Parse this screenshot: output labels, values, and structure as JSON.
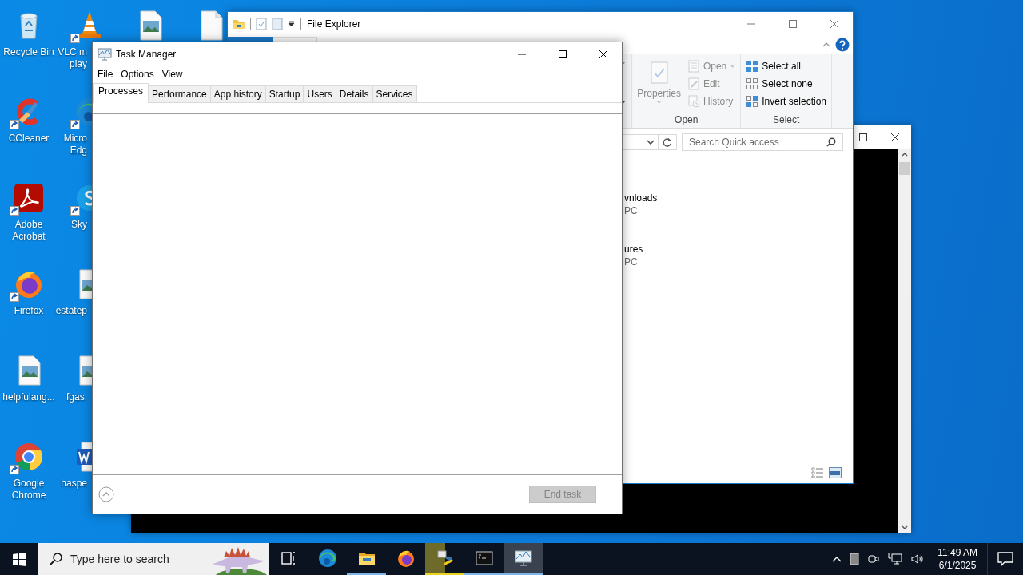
{
  "desktop": {
    "columns": [
      [
        {
          "kind": "recycle-bin",
          "shortcut": false,
          "label_lines": [
            "Recycle Bin"
          ]
        },
        {
          "kind": "ccleaner",
          "shortcut": true,
          "label_lines": [
            "CCleaner"
          ]
        },
        {
          "kind": "acrobat",
          "shortcut": true,
          "label_lines": [
            "Adobe",
            "Acrobat"
          ]
        },
        {
          "kind": "firefox",
          "shortcut": true,
          "label_lines": [
            "Firefox"
          ]
        },
        {
          "kind": "image-file",
          "shortcut": false,
          "label_lines": [
            "helpfulang..."
          ]
        },
        {
          "kind": "chrome",
          "shortcut": true,
          "label_lines": [
            "Google",
            "Chrome"
          ]
        }
      ],
      [
        {
          "kind": "vlc",
          "shortcut": true,
          "label_lines": [
            "VLC m",
            "play"
          ]
        },
        {
          "kind": "edge",
          "shortcut": true,
          "label_lines": [
            "Micro",
            "Edg"
          ]
        },
        {
          "kind": "skype",
          "shortcut": true,
          "label_lines": [
            "Sky"
          ]
        },
        {
          "kind": "image-file",
          "shortcut": false,
          "label_lines": [
            "estatep"
          ]
        },
        {
          "kind": "image-file",
          "shortcut": false,
          "label_lines": [
            "fgas."
          ]
        },
        {
          "kind": "word-file",
          "shortcut": false,
          "label_lines": [
            "haspe"
          ]
        }
      ],
      [
        {
          "kind": "image-file",
          "shortcut": false
        }
      ],
      [
        {
          "kind": "blank-file",
          "shortcut": false
        }
      ]
    ]
  },
  "file_explorer": {
    "title": "File Explorer",
    "ribbon_groups": [
      {
        "label": "Open",
        "items": [
          {
            "kind": "properties",
            "label": "Properties",
            "disabled": true
          },
          {
            "kind": "open",
            "label": "Open",
            "disabled": true
          },
          {
            "kind": "edit",
            "label": "Edit",
            "disabled": true
          },
          {
            "kind": "history",
            "label": "History",
            "disabled": true
          }
        ]
      },
      {
        "label": "Select",
        "items": [
          {
            "kind": "select-all",
            "label": "Select all",
            "disabled": false
          },
          {
            "kind": "select-none",
            "label": "Select none",
            "disabled": false
          },
          {
            "kind": "invert",
            "label": "Invert selection",
            "disabled": false
          }
        ]
      }
    ],
    "search": {
      "placeholder": "Search Quick access"
    },
    "items": [
      {
        "name": "vnloads",
        "location": "PC"
      },
      {
        "name": "ures",
        "location": "PC"
      }
    ]
  },
  "task_manager": {
    "title": "Task Manager",
    "menu": [
      "File",
      "Options",
      "View"
    ],
    "tabs": [
      {
        "label": "Processes",
        "selected": true
      },
      {
        "label": "Performance",
        "selected": false
      },
      {
        "label": "App history",
        "selected": false
      },
      {
        "label": "Startup",
        "selected": false
      },
      {
        "label": "Users",
        "selected": false
      },
      {
        "label": "Details",
        "selected": false
      },
      {
        "label": "Services",
        "selected": false
      }
    ],
    "end_task": {
      "label": "End task",
      "disabled": true
    }
  },
  "taskbar": {
    "search": {
      "placeholder": "Type here to search"
    },
    "apps": [
      {
        "kind": "task-view",
        "running": false,
        "active": false,
        "attention": false
      },
      {
        "kind": "edge",
        "running": false,
        "active": false,
        "attention": false
      },
      {
        "kind": "file-explorer",
        "running": true,
        "active": false,
        "attention": false
      },
      {
        "kind": "firefox",
        "running": false,
        "active": false,
        "attention": false
      },
      {
        "kind": "python",
        "running": true,
        "active": false,
        "attention": true
      },
      {
        "kind": "console",
        "running": true,
        "active": false,
        "attention": false
      },
      {
        "kind": "task-manager",
        "running": true,
        "active": true,
        "attention": false
      }
    ],
    "clock": {
      "time": "11:49 AM",
      "date": "6/1/2025"
    }
  }
}
